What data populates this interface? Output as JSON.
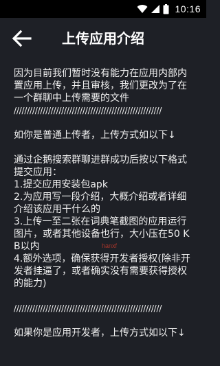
{
  "status_bar": {
    "time": "10:16"
  },
  "header": {
    "title": "上传应用介绍"
  },
  "content": {
    "intro": "因为目前我们暂时没有能力在应用内部内置应用上传，并且审核，我们更改为了在一个群聊中上传需要的文件",
    "separator": "////////////////////////////////////////////////////////",
    "normal_heading": "如你是普通上传者，上传方式如以下↓",
    "join_line": "通过企鹅搜索群聊进群成功后按以下格式提交应用：",
    "steps": [
      "1.提交应用安装包apk",
      "2.为应用写一段介绍，大概介绍或者详细介绍该应用干什么的",
      "3.上传一至二张在词典笔截图的应用运行图片，或者其他设备也行，大小压在50 KB以内",
      "4.额外选项，确保获得开发者授权(除非开发者挂逼了，或者确实没有需要获得授权的能力)"
    ],
    "separator2": "////////////////////////////////////////////////////////",
    "dev_heading": "如果你是应用开发者，上传方式如以下↓"
  },
  "watermark": "hanxf",
  "colors": {
    "background": "#1e2026",
    "status_bar": "#000000",
    "text": "#f0f0f0"
  },
  "icons": {
    "wifi": "wifi-icon",
    "signal": "signal-icon",
    "battery": "battery-icon",
    "back": "arrow-left-icon"
  }
}
